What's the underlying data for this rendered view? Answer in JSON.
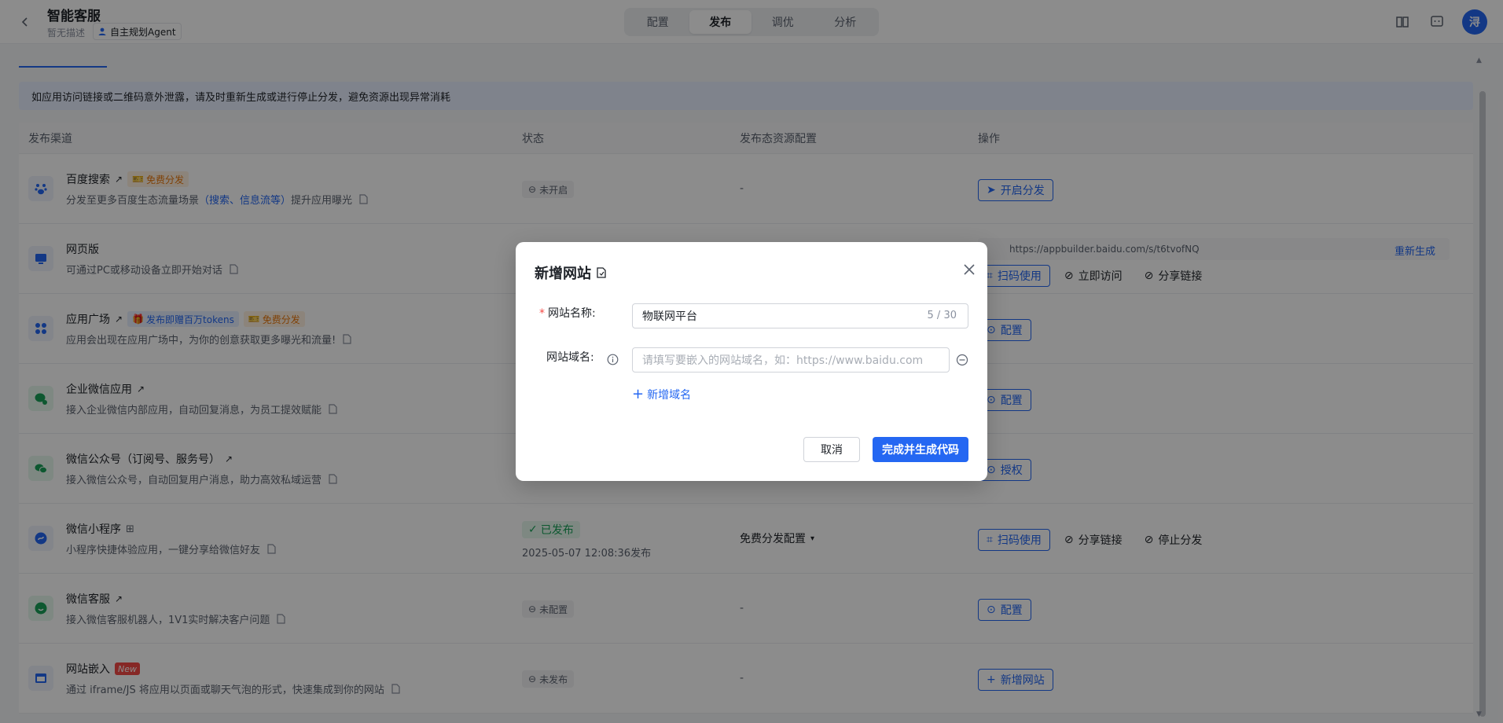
{
  "header": {
    "title": "智能客服",
    "desc": "暂无描述",
    "agent_tag": "自主规划Agent",
    "tabs": [
      "配置",
      "发布",
      "调优",
      "分析"
    ],
    "avatar": "浔"
  },
  "notice": "如应用访问链接或二维码意外泄露，请及时重新生成或进行停止分发，避免资源出现异常消耗",
  "table": {
    "headers": [
      "发布渠道",
      "状态",
      "发布态资源配置",
      "操作"
    ],
    "rows": [
      {
        "name": "百度搜索",
        "badge": "免费分发",
        "desc_pre": "分发至更多百度生态流量场景",
        "desc_hl": "（搜索、信息流等）",
        "desc_post": "提升应用曝光",
        "status": "未开启",
        "res": "-",
        "op": "开启分发"
      },
      {
        "name": "网页版",
        "desc": "可通过PC或移动设备立即开始对话",
        "url": "https://appbuilder.baidu.com/s/t6tvofNQ",
        "regen": "重新生成",
        "ops": [
          "扫码使用",
          "立即访问",
          "分享链接"
        ]
      },
      {
        "name": "应用广场",
        "badge_blue": "发布即赠百万tokens",
        "badge": "免费分发",
        "desc": "应用会出现在应用广场中，为你的创意获取更多曝光和流量!",
        "op": "配置"
      },
      {
        "name": "企业微信应用",
        "desc": "接入企业微信内部应用，自动回复消息，为员工提效赋能",
        "op": "配置"
      },
      {
        "name": "微信公众号（订阅号、服务号）",
        "desc": "接入微信公众号，自动回复用户消息，助力高效私域运营",
        "op": "授权"
      },
      {
        "name": "微信小程序",
        "desc": "小程序快捷体验应用，一键分享给微信好友",
        "status": "已发布",
        "time": "2025-05-07 12:08:36发布",
        "res": "免费分发配置",
        "ops": [
          "扫码使用",
          "分享链接",
          "停止分发"
        ]
      },
      {
        "name": "微信客服",
        "desc": "接入微信客服机器人，1V1实时解决客户问题",
        "status": "未配置",
        "res": "-",
        "op": "配置"
      },
      {
        "name": "网站嵌入",
        "badge_new": "New",
        "desc": "通过 iframe/JS 将应用以页面或聊天气泡的形式，快速集成到你的网站",
        "status": "未发布",
        "res": "-",
        "op": "新增网站"
      }
    ]
  },
  "modal": {
    "title": "新增网站",
    "name_label": "网站名称:",
    "name_value": "物联网平台",
    "name_counter": "5 / 30",
    "domain_label": "网站域名:",
    "domain_placeholder": "请填写要嵌入的网站域名，如：https://www.baidu.com",
    "add_domain": "新增域名",
    "cancel": "取消",
    "submit": "完成并生成代码"
  },
  "colors": {
    "primary": "#2467f2",
    "success": "#18a058",
    "warning": "#e8770c",
    "danger": "#f54a45"
  }
}
